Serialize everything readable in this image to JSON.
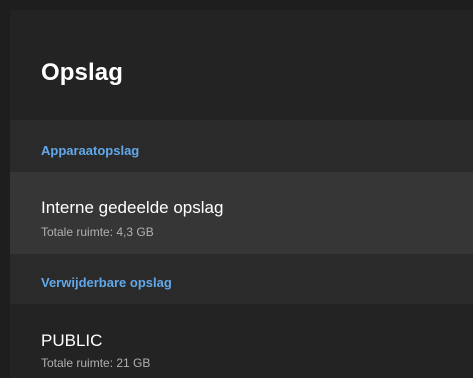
{
  "header": {
    "title": "Opslag"
  },
  "sections": [
    {
      "label": "Apparaatopslag",
      "items": [
        {
          "title": "Interne gedeelde opslag",
          "subtitle": "Totale ruimte: 4,3 GB"
        }
      ]
    },
    {
      "label": "Verwijderbare opslag",
      "items": [
        {
          "title": "PUBLIC",
          "subtitle": "Totale ruimte: 21 GB"
        }
      ]
    }
  ],
  "colors": {
    "accent": "#62a8ea",
    "background": "#1c1c1c",
    "selected_item": "#363636"
  }
}
